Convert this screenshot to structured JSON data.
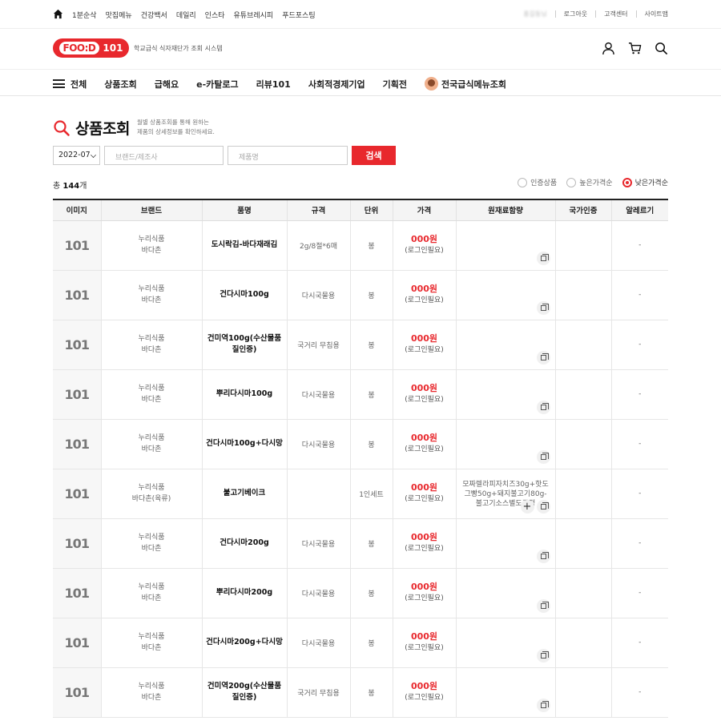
{
  "topbar": {
    "links": [
      "1분순삭",
      "맛집메뉴",
      "건강백서",
      "데일리",
      "인스타",
      "유튜브레시피",
      "푸드포스팅"
    ],
    "user_name": "홍길동님",
    "logout": "로그아웃",
    "support": "고객센터",
    "sitemap": "사이트맵"
  },
  "header": {
    "logo_text": "FOO:D",
    "logo_number": "101",
    "tagline": "학교급식 식자재단가 조회 시스템",
    "icons": [
      "user-icon",
      "cart-icon",
      "search-icon"
    ]
  },
  "gnb": {
    "all_label": "전체",
    "items": [
      "상품조회",
      "급해요",
      "e-카탈로그",
      "리뷰101",
      "사회적경제기업",
      "기획전"
    ],
    "special_item": "전국급식메뉴조회"
  },
  "page": {
    "title": "상품조회",
    "desc_line1": "월별 상품조회를 통해 원하는",
    "desc_line2": "제품의 상세정보를 확인하세요."
  },
  "filters": {
    "month": "2022-07",
    "brand_placeholder": "브랜드/제조사",
    "name_placeholder": "제품명",
    "search_label": "검색"
  },
  "summary": {
    "total_prefix": "총",
    "total_count": "144",
    "total_suffix": "개"
  },
  "sort": {
    "options": [
      "인증상품",
      "높은가격순",
      "낮은가격순"
    ],
    "selected_index": 2
  },
  "table": {
    "headers": [
      "이미지",
      "브랜드",
      "품명",
      "규격",
      "단위",
      "가격",
      "원재료함량",
      "국가인증",
      "알레르기"
    ],
    "rows": [
      {
        "brand1": "누리식품",
        "brand2": "바다촌",
        "name": "도시락김-바다재래김",
        "name2": "",
        "spec": "2g/8절*6매",
        "unit": "봉",
        "price": "000원",
        "note": "(로그인필요)",
        "ingredient": "",
        "cert": "",
        "allergy": "-"
      },
      {
        "brand1": "누리식품",
        "brand2": "바다촌",
        "name": "건다시마100g",
        "name2": "",
        "spec": "다시국물용",
        "unit": "봉",
        "price": "000원",
        "note": "(로그인필요)",
        "ingredient": "",
        "cert": "",
        "allergy": "-"
      },
      {
        "brand1": "누리식품",
        "brand2": "바다촌",
        "name": "건미역100g(수산물품",
        "name2": "질인증)",
        "spec": "국거리 무침용",
        "unit": "봉",
        "price": "000원",
        "note": "(로그인필요)",
        "ingredient": "",
        "cert": "",
        "allergy": "-"
      },
      {
        "brand1": "누리식품",
        "brand2": "바다촌",
        "name": "뿌리다시마100g",
        "name2": "",
        "spec": "다시국물용",
        "unit": "봉",
        "price": "000원",
        "note": "(로그인필요)",
        "ingredient": "",
        "cert": "",
        "allergy": "-"
      },
      {
        "brand1": "누리식품",
        "brand2": "바다촌",
        "name": "건다시마100g+다시망",
        "name2": "",
        "spec": "다시국물용",
        "unit": "봉",
        "price": "000원",
        "note": "(로그인필요)",
        "ingredient": "",
        "cert": "",
        "allergy": "-"
      },
      {
        "brand1": "누리식품",
        "brand2": "바다촌(육류)",
        "name": "불고기베이크",
        "name2": "",
        "spec": "",
        "unit": "1인세트",
        "price": "000원",
        "note": "(로그인필요)",
        "ingredient": "모짜렐라피자치즈30g+핫도그빵50g+돼지불고기80g-불고기소스별도증정",
        "cert": "",
        "allergy": "-",
        "has_plus": true
      },
      {
        "brand1": "누리식품",
        "brand2": "바다촌",
        "name": "건다시마200g",
        "name2": "",
        "spec": "다시국물용",
        "unit": "봉",
        "price": "000원",
        "note": "(로그인필요)",
        "ingredient": "",
        "cert": "",
        "allergy": "-"
      },
      {
        "brand1": "누리식품",
        "brand2": "바다촌",
        "name": "뿌리다시마200g",
        "name2": "",
        "spec": "다시국물용",
        "unit": "봉",
        "price": "000원",
        "note": "(로그인필요)",
        "ingredient": "",
        "cert": "",
        "allergy": "-"
      },
      {
        "brand1": "누리식품",
        "brand2": "바다촌",
        "name": "건다시마200g+다시망",
        "name2": "",
        "spec": "다시국물용",
        "unit": "봉",
        "price": "000원",
        "note": "(로그인필요)",
        "ingredient": "",
        "cert": "",
        "allergy": "-"
      },
      {
        "brand1": "누리식품",
        "brand2": "바다촌",
        "name": "건미역200g(수산물품",
        "name2": "질인증)",
        "spec": "국거리 무침용",
        "unit": "봉",
        "price": "000원",
        "note": "(로그인필요)",
        "ingredient": "",
        "cert": "",
        "allergy": "-"
      }
    ]
  },
  "colors": {
    "accent": "#e8282d",
    "header_bg": "#f4f4f4"
  }
}
